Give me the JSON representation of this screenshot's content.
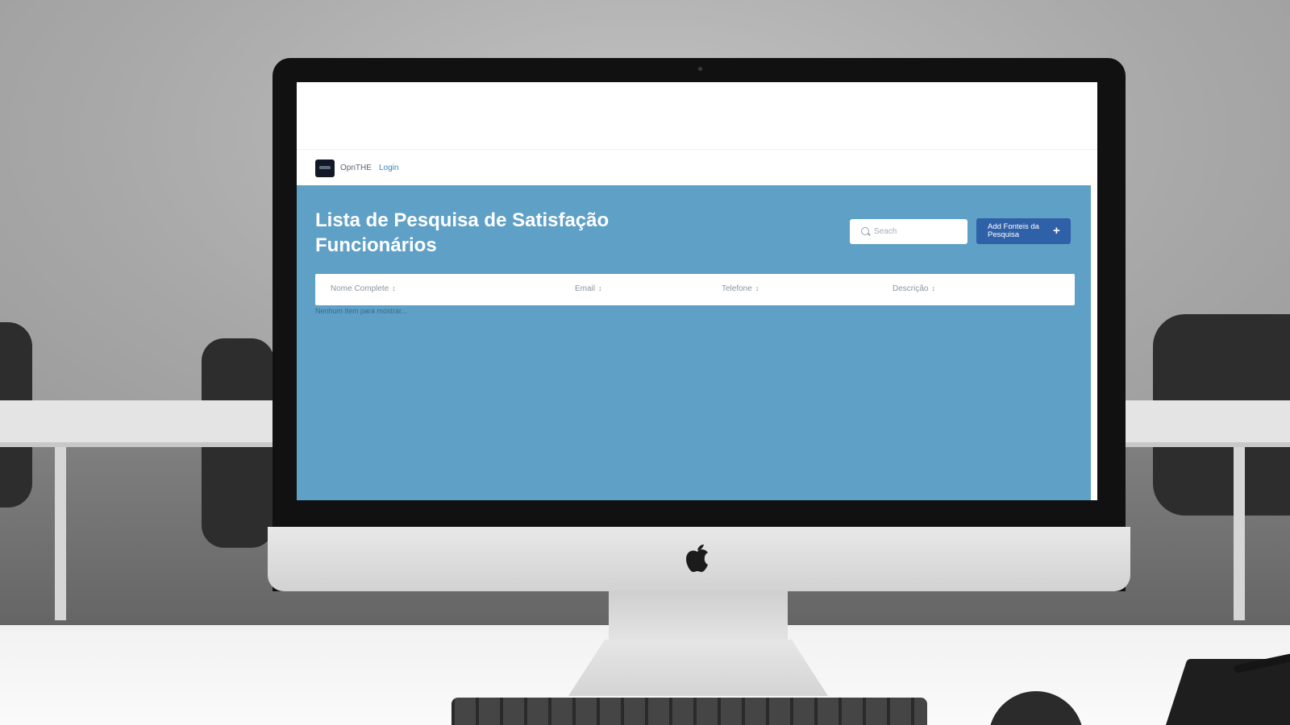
{
  "app": {
    "brand": "OpnTHE",
    "login_link": "Login"
  },
  "page": {
    "title": "Lista de Pesquisa de Satisfação Funcionários"
  },
  "search": {
    "placeholder": "Seach"
  },
  "add_button": {
    "label": "Add Fonteis da Pesquisa",
    "icon": "plus-icon"
  },
  "table": {
    "columns": [
      {
        "label": "Nome Complete",
        "sort_icon": "↕"
      },
      {
        "label": "Email",
        "sort_icon": "↕"
      },
      {
        "label": "Telefone",
        "sort_icon": "↕"
      },
      {
        "label": "Descrição",
        "sort_icon": "↕"
      }
    ],
    "empty_message": "Nenhum item para mostrar..."
  },
  "colors": {
    "content_background": "#5fa0c7",
    "button_background": "#2f61a8",
    "login_link": "#3f7fc1",
    "logo_background": "#121826"
  }
}
